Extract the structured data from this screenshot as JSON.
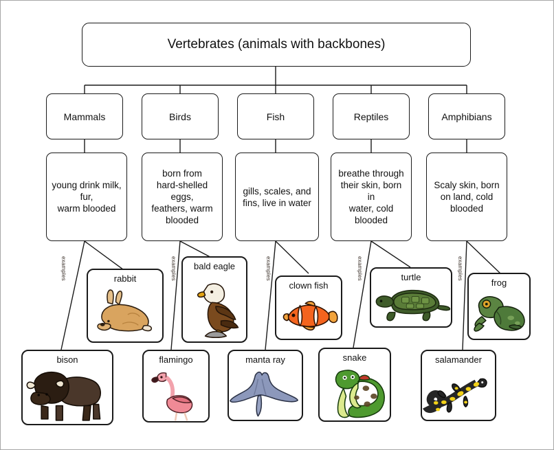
{
  "diagram": {
    "title": "Vertebrates (animals with backbones)",
    "connector_label": "examples",
    "branches": [
      {
        "name": "Mammals",
        "description": "young drink milk,\nfur,\nwarm blooded",
        "examples": [
          {
            "label": "rabbit",
            "art": "rabbit-illustration"
          },
          {
            "label": "bison",
            "art": "bison-illustration"
          }
        ]
      },
      {
        "name": "Birds",
        "description": "born from\nhard-shelled eggs,\nfeathers, warm\nblooded",
        "examples": [
          {
            "label": "bald eagle",
            "art": "bald-eagle-illustration"
          },
          {
            "label": "flamingo",
            "art": "flamingo-illustration"
          }
        ]
      },
      {
        "name": "Fish",
        "description": "gills, scales, and\nfins, live in water",
        "examples": [
          {
            "label": "clown fish",
            "art": "clown-fish-illustration"
          },
          {
            "label": "manta ray",
            "art": "manta-ray-illustration"
          }
        ]
      },
      {
        "name": "Reptiles",
        "description": "breathe through\ntheir skin, born in\nwater, cold\nblooded",
        "examples": [
          {
            "label": "turtle",
            "art": "turtle-illustration"
          },
          {
            "label": "snake",
            "art": "snake-illustration"
          }
        ]
      },
      {
        "name": "Amphibians",
        "description": "Scaly skin, born\non land, cold\nblooded",
        "examples": [
          {
            "label": "frog",
            "art": "frog-illustration"
          },
          {
            "label": "salamander",
            "art": "salamander-illustration"
          }
        ]
      }
    ]
  },
  "colors": {
    "line": "#1a1a1a",
    "frame": "#a6a6a6",
    "background": "#ffffff",
    "text": "#111111",
    "rabbit": "#d9a45f",
    "bison": "#4a372a",
    "eagle_body": "#7a4a1e",
    "eagle_head": "#f4efe2",
    "flamingo": "#f08a96",
    "clownfish": "#f4641e",
    "mantaray": "#8c98bb",
    "turtle": "#3f5c2a",
    "snake": "#4e9a2f",
    "frog": "#4e7a3a",
    "salamander": "#262626",
    "salamander_spots": "#f2d118"
  }
}
